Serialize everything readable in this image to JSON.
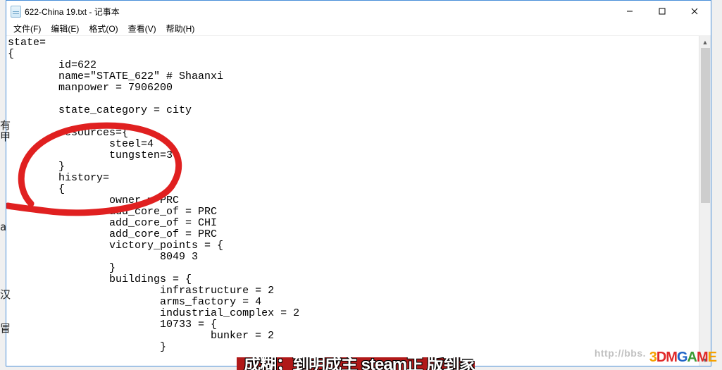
{
  "window": {
    "title": "622-China 19.txt - 记事本"
  },
  "menu": {
    "file": "文件(F)",
    "edit": "编辑(E)",
    "format": "格式(O)",
    "view": "查看(V)",
    "help": "帮助(H)"
  },
  "editor": {
    "content": "state=\n{\n\tid=622\n\tname=\"STATE_622\" # Shaanxi\n\tmanpower = 7906200\n\t\n\tstate_category = city\n\n\tresources={\n\t\tsteel=4\n\t\ttungsten=3\n\t}\n\thistory=\n\t{\n\t\towner = PRC\n\t\tadd_core_of = PRC\n\t\tadd_core_of = CHI\n\t\tadd_core_of = PRC\n\t\tvictory_points = {\n\t\t\t8049 3 \n\t\t}\n\t\tbuildings = {\n\t\t\tinfrastructure = 2\n\t\t\tarms_factory = 4\n\t\t\tindustrial_complex = 2\n\t\t\t10733 = {\n\t\t\t\tbunker = 2\n\t\t\t}"
  },
  "watermark": {
    "url": "http://bbs."
  },
  "steam_strip": "成糊；到明成主 steam正 版到家",
  "left_frags": [
    "有",
    "甲",
    "",
    "",
    "",
    "",
    "",
    "",
    "",
    "a",
    "",
    "",
    "",
    "",
    "",
    "汉",
    "",
    "",
    "冒"
  ]
}
